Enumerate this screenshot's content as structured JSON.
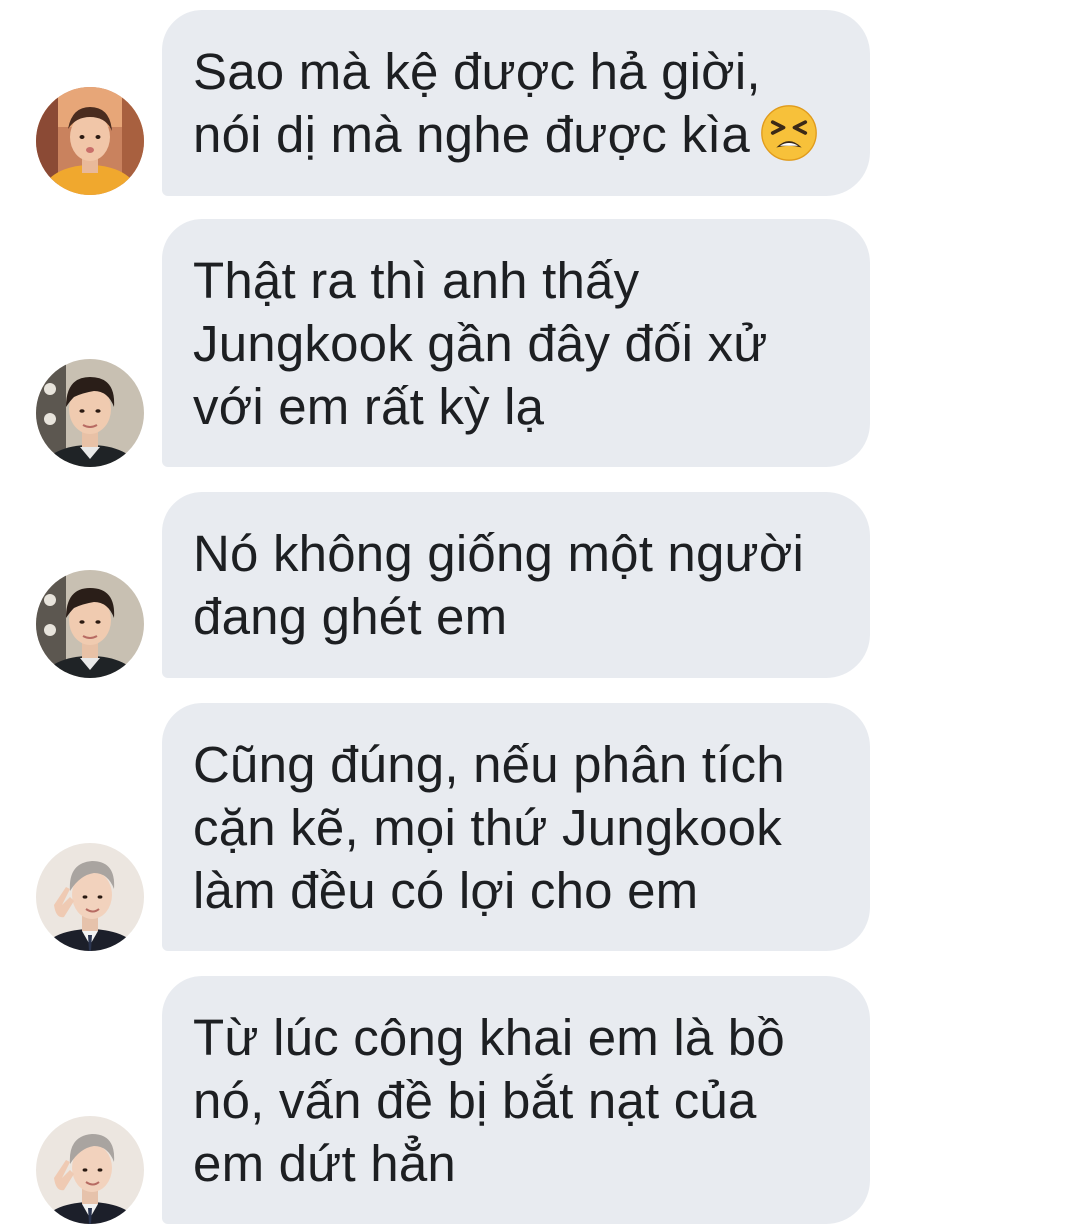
{
  "messages": [
    {
      "sender_avatar": "avatar-orange-shirt",
      "text": "Sao mà kệ được hả giời,\nnói dị mà nghe được kìa",
      "emoji": "tired-face-emoji"
    },
    {
      "sender_avatar": "avatar-dark-hair-suit",
      "text": "Thật ra thì anh thấy\nJungkook gần đây đối xử\nvới em rất kỳ lạ"
    },
    {
      "sender_avatar": "avatar-dark-hair-suit",
      "text": "Nó không giống một người\nđang ghét em"
    },
    {
      "sender_avatar": "avatar-gray-hair-suit",
      "text": "Cũng đúng, nếu phân tích\ncặn kẽ, mọi thứ Jungkook\nlàm đều có lợi cho em"
    },
    {
      "sender_avatar": "avatar-gray-hair-suit",
      "text": "Từ lúc công khai em là bồ\nnó, vấn đề bị bắt nạt của\nem dứt hẳn"
    }
  ],
  "colors": {
    "bubble_bg": "#e8ebf0",
    "text": "#1d1f22",
    "background": "#ffffff"
  }
}
